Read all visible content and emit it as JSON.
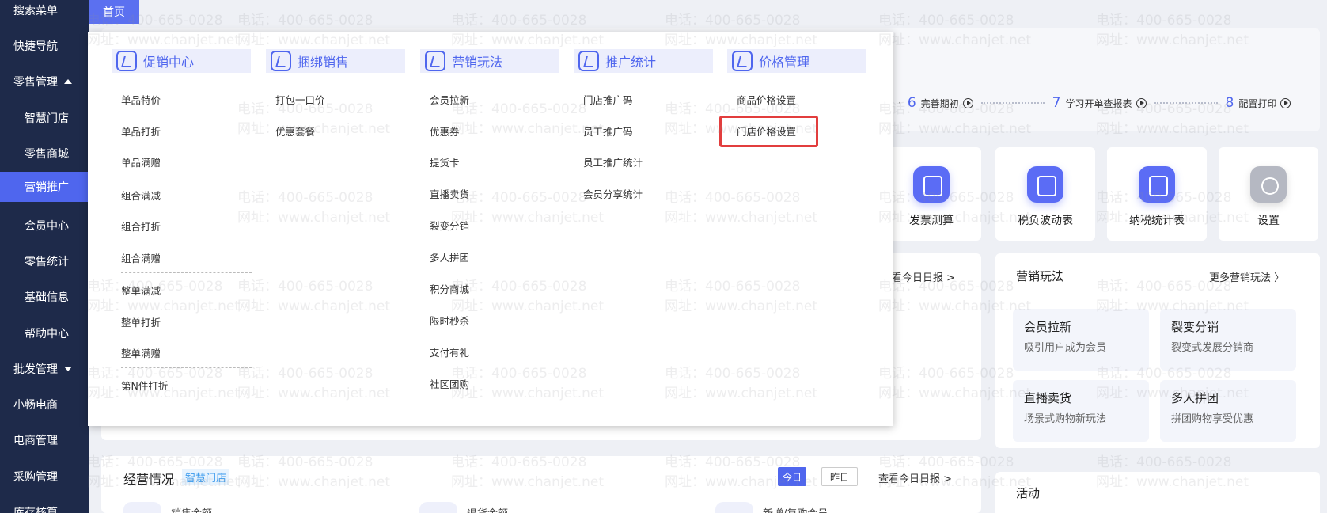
{
  "sidebar": {
    "items": [
      {
        "label": "搜索菜单"
      },
      {
        "label": "快捷导航"
      },
      {
        "label": "零售管理"
      },
      {
        "label": "智慧门店"
      },
      {
        "label": "零售商城"
      },
      {
        "label": "营销推广"
      },
      {
        "label": "会员中心"
      },
      {
        "label": "零售统计"
      },
      {
        "label": "基础信息"
      },
      {
        "label": "帮助中心"
      },
      {
        "label": "批发管理"
      },
      {
        "label": "小畅电商"
      },
      {
        "label": "电商管理"
      },
      {
        "label": "采购管理"
      },
      {
        "label": "库存核算"
      }
    ]
  },
  "tabs": {
    "home": "首页"
  },
  "steps": [
    {
      "num": "6",
      "label": "完善期初"
    },
    {
      "num": "7",
      "label": "学习开单查报表"
    },
    {
      "num": "8",
      "label": "配置打印"
    }
  ],
  "tools": [
    {
      "label": "发票测算"
    },
    {
      "label": "税负波动表"
    },
    {
      "label": "纳税统计表"
    },
    {
      "label": "设置"
    }
  ],
  "main": {
    "view_report": "看今日日报 >"
  },
  "marketing": {
    "title": "营销玩法",
    "more": "更多营销玩法 〉",
    "cards": [
      {
        "title": "会员拉新",
        "desc": "吸引用户成为会员"
      },
      {
        "title": "裂变分销",
        "desc": "裂变式发展分销商"
      },
      {
        "title": "直播卖货",
        "desc": "场景式购物新玩法"
      },
      {
        "title": "多人拼团",
        "desc": "拼团购物享受优惠"
      }
    ]
  },
  "business": {
    "title": "经营情况",
    "tag": "智慧门店",
    "today": "今日",
    "yesterday": "昨日",
    "report": "查看今日日报 >",
    "metrics": [
      "销售金额",
      "退货金额",
      "新增/复购会员"
    ]
  },
  "activity": {
    "title": "活动"
  },
  "menu": {
    "columns": [
      {
        "title": "促销中心",
        "items": [
          "单品特价",
          "单品打折",
          "单品满赠",
          "组合满减",
          "组合打折",
          "组合满赠",
          "整单满减",
          "整单打折",
          "整单满赠",
          "第N件打折"
        ]
      },
      {
        "title": "捆绑销售",
        "items": [
          "打包一口价",
          "优惠套餐"
        ]
      },
      {
        "title": "营销玩法",
        "items": [
          "会员拉新",
          "优惠券",
          "提货卡",
          "直播卖货",
          "裂变分销",
          "多人拼团",
          "积分商城",
          "限时秒杀",
          "支付有礼",
          "社区团购"
        ]
      },
      {
        "title": "推广统计",
        "items": [
          "门店推广码",
          "员工推广码",
          "员工推广统计",
          "会员分享统计"
        ]
      },
      {
        "title": "价格管理",
        "items": [
          "商品价格设置",
          "门店价格设置"
        ]
      }
    ]
  },
  "watermark": {
    "phone": "电话：400-665-0028",
    "site": "网址：www.chanjet.net"
  }
}
